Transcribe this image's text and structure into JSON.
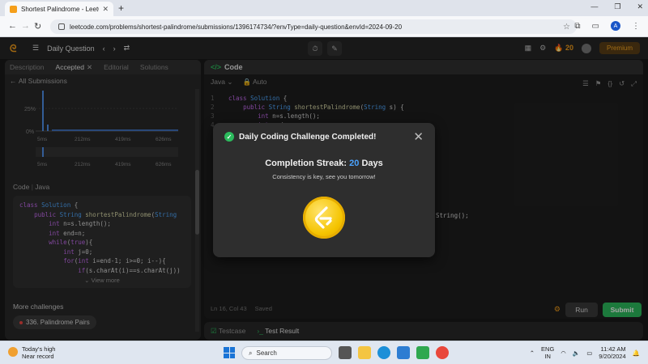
{
  "browser": {
    "tab_title": "Shortest Palindrome - LeetCode",
    "new_tab": "+",
    "url": "leetcode.com/problems/shortest-palindrome/submissions/1396174734/?envType=daily-question&envId=2024-09-20"
  },
  "header": {
    "daily_question": "Daily Question",
    "streak_count": "20",
    "premium": "Premium"
  },
  "left_panel": {
    "tabs": {
      "description": "Description",
      "accepted": "Accepted",
      "editorial": "Editorial",
      "solutions": "Solutions"
    },
    "all_submissions": "All Submissions",
    "chart": {
      "y_labels": [
        "25%",
        "0%"
      ],
      "x_labels": [
        "5ms",
        "212ms",
        "419ms",
        "626ms"
      ],
      "mini_x_labels": [
        "5ms",
        "212ms",
        "419ms",
        "626ms"
      ]
    },
    "code_label": "Code",
    "code_lang": "Java",
    "view_more": "View more",
    "more_challenges": "More challenges",
    "challenge_chip": "336. Palindrome Pairs"
  },
  "right_panel": {
    "title": "Code",
    "lang": "Java",
    "mode": "Auto",
    "status": "Ln 16, Col 43",
    "saved": "Saved",
    "code_fragment": "String();",
    "run": "Run",
    "submit": "Submit"
  },
  "test_panel": {
    "testcase": "Testcase",
    "result": "Test Result"
  },
  "modal": {
    "title": "Daily Coding Challenge Completed!",
    "streak_prefix": "Completion Streak:",
    "streak_value": "20",
    "streak_suffix": "Days",
    "message": "Consistency is key, see you tomorrow!"
  },
  "taskbar": {
    "weather_title": "Today's high",
    "weather_sub": "Near record",
    "search": "Search",
    "lang1": "ENG",
    "lang2": "IN",
    "time": "11:42 AM",
    "date": "9/20/2024"
  },
  "colors": {
    "accent": "#2cbb5d",
    "brand": "#f59f1b",
    "streak_blue": "#4aa3ff"
  }
}
